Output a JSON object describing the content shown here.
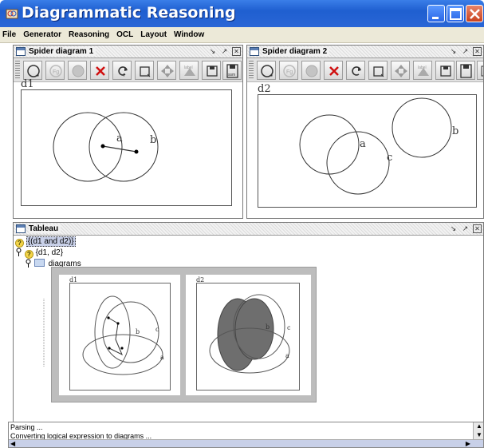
{
  "window": {
    "title": "Diagrammatic Reasoning"
  },
  "menu": [
    "File",
    "Generator",
    "Reasoning",
    "OCL",
    "Layout",
    "Window"
  ],
  "frames": {
    "spider1": {
      "title": "Spider diagram 1",
      "diagram_label": "d1",
      "contours": [
        "a",
        "b"
      ]
    },
    "spider2": {
      "title": "Spider diagram 2",
      "diagram_label": "d2",
      "contours": [
        "a",
        "b",
        "c"
      ]
    },
    "tableau": {
      "title": "Tableau"
    }
  },
  "toolbar": {
    "buttons": [
      "new-diagram",
      "fg",
      "circle",
      "delete",
      "refresh",
      "frame",
      "move",
      "label",
      "save",
      "save-as",
      "print"
    ]
  },
  "tree": {
    "nodes": [
      {
        "text": "{(d1 and d2)}",
        "icon": "question-icon"
      },
      {
        "text": "{d1, d2}",
        "icon": "question-icon"
      },
      {
        "text": "diagrams",
        "icon": "folder-icon"
      }
    ]
  },
  "preview": {
    "left": {
      "label": "d1",
      "contours": [
        "b",
        "c",
        "a"
      ]
    },
    "right": {
      "label": "d2",
      "contours": [
        "b",
        "c",
        "a"
      ]
    }
  },
  "console": {
    "lines": [
      "Parsing ...",
      "Converting logical expression to diagrams ..."
    ]
  },
  "colors": {
    "titlebar": "#2a66d6",
    "shaded_zone": "#6e6e6e"
  }
}
